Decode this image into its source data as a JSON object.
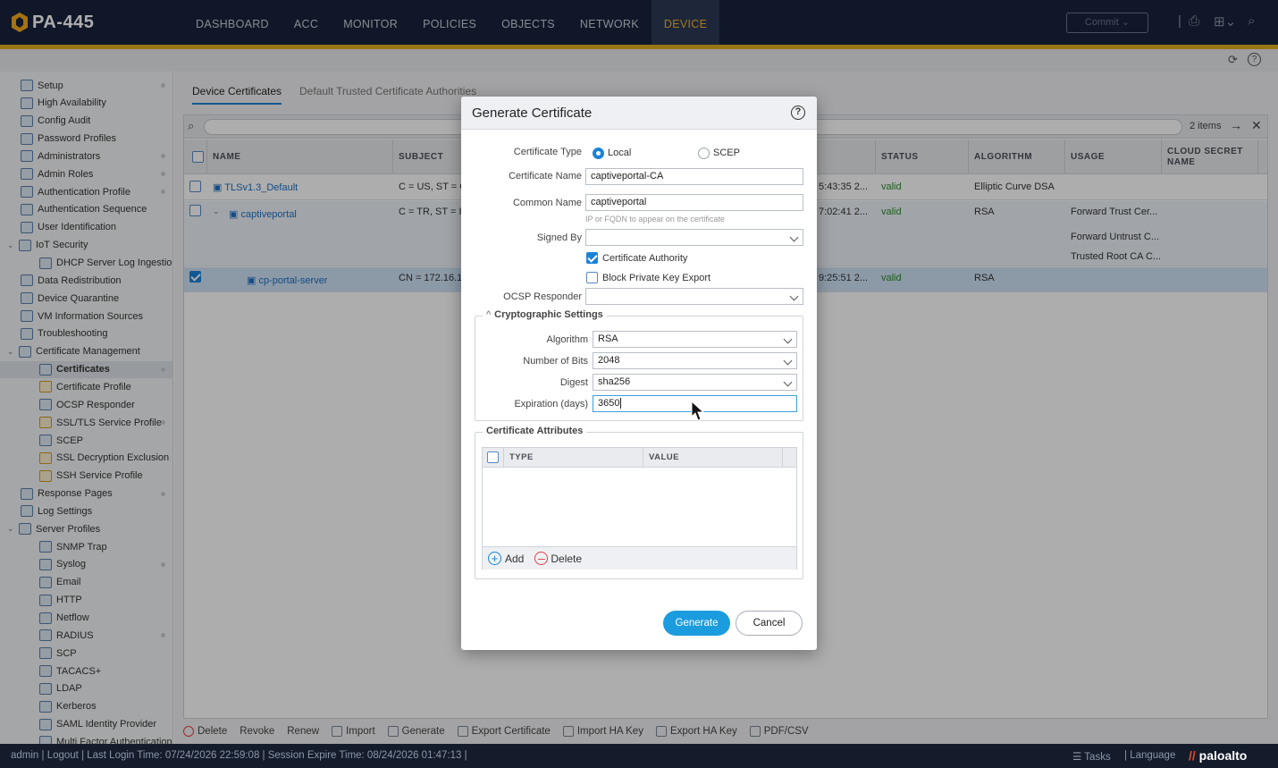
{
  "app": {
    "name": "PA-445"
  },
  "nav": [
    "DASHBOARD",
    "ACC",
    "MONITOR",
    "POLICIES",
    "OBJECTS",
    "NETWORK",
    "DEVICE"
  ],
  "nav_active": "DEVICE",
  "commit_label": "Commit",
  "sidebar": {
    "items": [
      {
        "label": "Setup",
        "dot": true
      },
      {
        "label": "High Availability"
      },
      {
        "label": "Config Audit"
      },
      {
        "label": "Password Profiles"
      },
      {
        "label": "Administrators",
        "dot": true
      },
      {
        "label": "Admin Roles",
        "dot": true
      },
      {
        "label": "Authentication Profile",
        "dot": true
      },
      {
        "label": "Authentication Sequence"
      },
      {
        "label": "User Identification"
      },
      {
        "label": "IoT Security",
        "expanded": true
      },
      {
        "label": "DHCP Server Log Ingestion",
        "child": true
      },
      {
        "label": "Data Redistribution"
      },
      {
        "label": "Device Quarantine"
      },
      {
        "label": "VM Information Sources"
      },
      {
        "label": "Troubleshooting"
      },
      {
        "label": "Certificate Management",
        "expanded": true
      },
      {
        "label": "Certificates",
        "child": true,
        "selected": true,
        "dot": true
      },
      {
        "label": "Certificate Profile",
        "child": true
      },
      {
        "label": "OCSP Responder",
        "child": true
      },
      {
        "label": "SSL/TLS Service Profile",
        "child": true,
        "dot": true
      },
      {
        "label": "SCEP",
        "child": true
      },
      {
        "label": "SSL Decryption Exclusion",
        "child": true
      },
      {
        "label": "SSH Service Profile",
        "child": true
      },
      {
        "label": "Response Pages",
        "dot": true
      },
      {
        "label": "Log Settings"
      },
      {
        "label": "Server Profiles",
        "expanded": true
      },
      {
        "label": "SNMP Trap",
        "child": true
      },
      {
        "label": "Syslog",
        "child": true,
        "dot": true
      },
      {
        "label": "Email",
        "child": true
      },
      {
        "label": "HTTP",
        "child": true
      },
      {
        "label": "Netflow",
        "child": true
      },
      {
        "label": "RADIUS",
        "child": true,
        "dot": true
      },
      {
        "label": "SCP",
        "child": true
      },
      {
        "label": "TACACS+",
        "child": true
      },
      {
        "label": "LDAP",
        "child": true
      },
      {
        "label": "Kerberos",
        "child": true
      },
      {
        "label": "SAML Identity Provider",
        "child": true
      },
      {
        "label": "Multi Factor Authentication",
        "child": true
      }
    ]
  },
  "tabs": [
    "Device Certificates",
    "Default Trusted Certificate Authorities"
  ],
  "grid": {
    "count": "2 items",
    "columns": [
      "NAME",
      "SUBJECT",
      "S",
      "STATUS",
      "ALGORITHM",
      "USAGE",
      "CLOUD SECRET NAME"
    ],
    "rows": [
      {
        "name": "TLSv1.3_Default",
        "subject": "C = US, ST = CA",
        "time": "5:43:35 2...",
        "status": "valid",
        "algorithm": "Elliptic Curve DSA",
        "usage": ""
      },
      {
        "name": "captiveportal",
        "subject": "C = TR, ST = Ist",
        "time": "7:02:41 2...",
        "status": "valid",
        "algorithm": "RSA",
        "usage": "Forward Trust Cer...",
        "usage2": "Forward Untrust C...",
        "usage3": "Trusted Root CA C..."
      },
      {
        "name": "cp-portal-server",
        "subject": "CN = 172.16.1.",
        "time": "9:25:51 2...",
        "status": "valid",
        "algorithm": "RSA",
        "usage": ""
      }
    ]
  },
  "bottom_toolbar": [
    "Delete",
    "Revoke",
    "Renew",
    "Import",
    "Generate",
    "Export Certificate",
    "Import HA Key",
    "Export HA Key",
    "PDF/CSV"
  ],
  "dialog": {
    "title": "Generate Certificate",
    "cert_type_label": "Certificate Type",
    "cert_type_local": "Local",
    "cert_type_scep": "SCEP",
    "cert_name_label": "Certificate Name",
    "cert_name_value": "captiveportal-CA",
    "common_name_label": "Common Name",
    "common_name_value": "captiveportal",
    "common_name_hint": "IP or FQDN to appear on the certificate",
    "signed_by_label": "Signed By",
    "signed_by_value": "",
    "ca_label": "Certificate Authority",
    "ca_checked": true,
    "block_label": "Block Private Key Export",
    "block_checked": false,
    "ocsp_label": "OCSP Responder",
    "ocsp_value": "",
    "crypto_title": "Cryptographic Settings",
    "algorithm_label": "Algorithm",
    "algorithm_value": "RSA",
    "bits_label": "Number of Bits",
    "bits_value": "2048",
    "digest_label": "Digest",
    "digest_value": "sha256",
    "expiration_label": "Expiration (days)",
    "expiration_value": "3650",
    "attributes_title": "Certificate Attributes",
    "attr_columns": [
      "TYPE",
      "VALUE"
    ],
    "add_label": "Add",
    "delete_label": "Delete",
    "generate_label": "Generate",
    "cancel_label": "Cancel"
  },
  "status_bar": {
    "text": "admin  |  Logout  |  Last Login Time: 07/24/2026 22:59:08  |  Session Expire Time: 08/24/2026 01:47:13  |",
    "tasks": "Tasks",
    "language": "Language",
    "brand": "paloalto"
  },
  "colors": {
    "accent": "#1b83d6",
    "nav_bg": "#17233b",
    "gold": "#e0ad1f",
    "valid": "#2f8a2f"
  }
}
